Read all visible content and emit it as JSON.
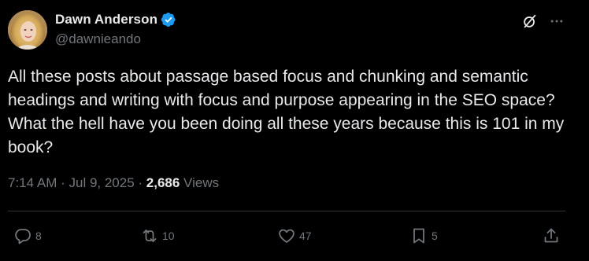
{
  "author": {
    "display_name": "Dawn Anderson",
    "handle": "@dawnieando",
    "verified": true
  },
  "tweet": {
    "text": "All these posts about passage based focus and chunking and semantic headings and writing with focus and purpose appearing in the SEO space? What the hell have you been doing all these years because this is 101 in my book?",
    "time": "7:14 AM",
    "separator1": " · ",
    "date": "Jul 9, 2025",
    "separator2": " · ",
    "views_count": "2,686",
    "views_label": " Views"
  },
  "actions": {
    "replies": "8",
    "reposts": "10",
    "likes": "47",
    "bookmarks": "5"
  },
  "icons": {
    "verified": "verified-badge-icon",
    "grok": "grok-icon",
    "more": "more-icon",
    "reply": "reply-icon",
    "repost": "repost-icon",
    "like": "heart-icon",
    "bookmark": "bookmark-icon",
    "share": "share-icon"
  },
  "colors": {
    "background": "#000000",
    "text": "#e7e9ea",
    "secondary": "#71767b",
    "divider": "#2f3336",
    "verified": "#1d9bf0"
  }
}
